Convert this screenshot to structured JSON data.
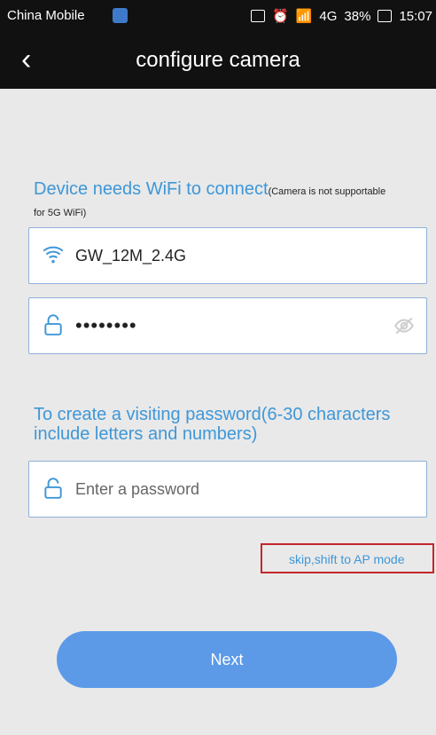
{
  "statusbar": {
    "carrier": "China Mobile",
    "network": "4G",
    "battery": "38%",
    "time": "15:07"
  },
  "header": {
    "title": "configure camera",
    "back_icon": "chevron-left-icon"
  },
  "wifi_section": {
    "heading": "Device needs WiFi to connect",
    "note": "(Camera is not supportable",
    "note2": "for 5G WiFi)"
  },
  "wifi_field": {
    "value": "GW_12M_2.4G",
    "icon": "wifi-icon"
  },
  "wifi_password": {
    "value": "••••••••",
    "icon": "lock-icon",
    "visibility_icon": "eye-off-icon"
  },
  "visit_section": {
    "heading": "To create a visiting password(6-30 characters include letters and numbers)"
  },
  "visit_password": {
    "placeholder": "Enter a password",
    "icon": "lock-icon"
  },
  "skip_link": "skip,shift to AP mode",
  "next_button": "Next",
  "colors": {
    "accent_blue": "#3e97d8",
    "button_blue": "#5c9ae8",
    "highlight_red": "#c3272c",
    "bg_gray": "#e9e9e9"
  }
}
